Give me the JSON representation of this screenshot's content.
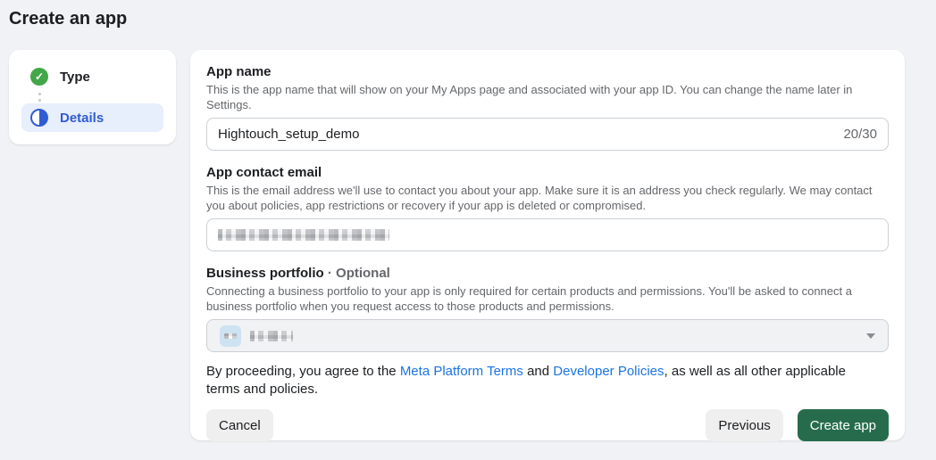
{
  "page": {
    "title": "Create an app"
  },
  "stepper": {
    "steps": [
      {
        "label": "Type",
        "state": "completed",
        "icon": "check-circle-icon"
      },
      {
        "label": "Details",
        "state": "current",
        "icon": "half-filled-circle-icon"
      }
    ]
  },
  "form": {
    "app_name": {
      "label": "App name",
      "help": "This is the app name that will show on your My Apps page and associated with your app ID. You can change the name later in Settings.",
      "value": "Hightouch_setup_demo",
      "counter": "20/30"
    },
    "contact_email": {
      "label": "App contact email",
      "help": "This is the email address we'll use to contact you about your app. Make sure it is an address you check regularly. We may contact you about policies, app restrictions or recovery if your app is deleted or compromised.",
      "value_state": "redacted"
    },
    "business_portfolio": {
      "label": "Business portfolio",
      "optional_label": "· Optional",
      "help": "Connecting a business portfolio to your app is only required for certain products and permissions. You'll be asked to connect a business portfolio when you request access to those products and permissions.",
      "value_state": "redacted",
      "icon": "portfolio-avatar",
      "dropdown_icon": "caret-down-icon"
    },
    "terms": {
      "prefix": "By proceeding, you agree to the ",
      "link1": "Meta Platform Terms",
      "middle": " and ",
      "link2": "Developer Policies",
      "suffix": ", as well as all other applicable terms and policies."
    },
    "buttons": {
      "cancel": "Cancel",
      "previous": "Previous",
      "create": "Create app"
    }
  },
  "colors": {
    "page_background": "#f0f2f5",
    "step_current_blue": "#2f5cd2",
    "step_current_bg": "#e7eefc",
    "success_green": "#42a748",
    "link_blue": "#1b74e4",
    "create_button_green": "#266c4c"
  },
  "icons": {
    "check": "✓"
  }
}
